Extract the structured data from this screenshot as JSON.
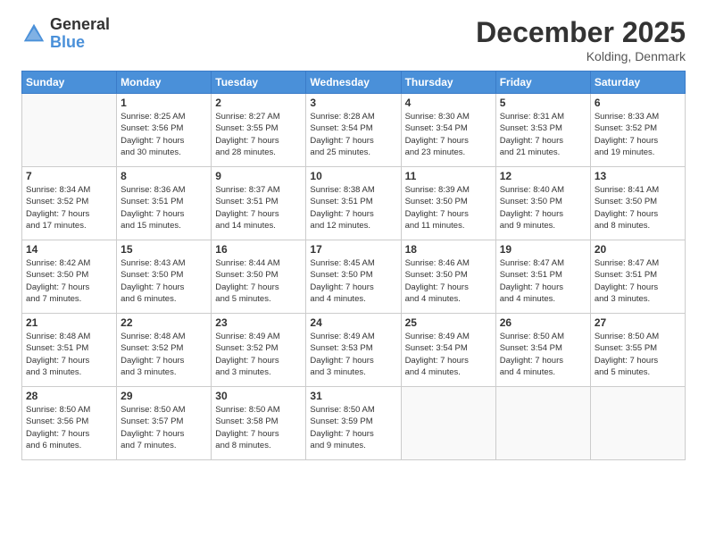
{
  "header": {
    "logo_general": "General",
    "logo_blue": "Blue",
    "title": "December 2025",
    "location": "Kolding, Denmark"
  },
  "days_of_week": [
    "Sunday",
    "Monday",
    "Tuesday",
    "Wednesday",
    "Thursday",
    "Friday",
    "Saturday"
  ],
  "weeks": [
    [
      {
        "day": null,
        "info": null
      },
      {
        "day": "1",
        "info": "Sunrise: 8:25 AM\nSunset: 3:56 PM\nDaylight: 7 hours\nand 30 minutes."
      },
      {
        "day": "2",
        "info": "Sunrise: 8:27 AM\nSunset: 3:55 PM\nDaylight: 7 hours\nand 28 minutes."
      },
      {
        "day": "3",
        "info": "Sunrise: 8:28 AM\nSunset: 3:54 PM\nDaylight: 7 hours\nand 25 minutes."
      },
      {
        "day": "4",
        "info": "Sunrise: 8:30 AM\nSunset: 3:54 PM\nDaylight: 7 hours\nand 23 minutes."
      },
      {
        "day": "5",
        "info": "Sunrise: 8:31 AM\nSunset: 3:53 PM\nDaylight: 7 hours\nand 21 minutes."
      },
      {
        "day": "6",
        "info": "Sunrise: 8:33 AM\nSunset: 3:52 PM\nDaylight: 7 hours\nand 19 minutes."
      }
    ],
    [
      {
        "day": "7",
        "info": "Sunrise: 8:34 AM\nSunset: 3:52 PM\nDaylight: 7 hours\nand 17 minutes."
      },
      {
        "day": "8",
        "info": "Sunrise: 8:36 AM\nSunset: 3:51 PM\nDaylight: 7 hours\nand 15 minutes."
      },
      {
        "day": "9",
        "info": "Sunrise: 8:37 AM\nSunset: 3:51 PM\nDaylight: 7 hours\nand 14 minutes."
      },
      {
        "day": "10",
        "info": "Sunrise: 8:38 AM\nSunset: 3:51 PM\nDaylight: 7 hours\nand 12 minutes."
      },
      {
        "day": "11",
        "info": "Sunrise: 8:39 AM\nSunset: 3:50 PM\nDaylight: 7 hours\nand 11 minutes."
      },
      {
        "day": "12",
        "info": "Sunrise: 8:40 AM\nSunset: 3:50 PM\nDaylight: 7 hours\nand 9 minutes."
      },
      {
        "day": "13",
        "info": "Sunrise: 8:41 AM\nSunset: 3:50 PM\nDaylight: 7 hours\nand 8 minutes."
      }
    ],
    [
      {
        "day": "14",
        "info": "Sunrise: 8:42 AM\nSunset: 3:50 PM\nDaylight: 7 hours\nand 7 minutes."
      },
      {
        "day": "15",
        "info": "Sunrise: 8:43 AM\nSunset: 3:50 PM\nDaylight: 7 hours\nand 6 minutes."
      },
      {
        "day": "16",
        "info": "Sunrise: 8:44 AM\nSunset: 3:50 PM\nDaylight: 7 hours\nand 5 minutes."
      },
      {
        "day": "17",
        "info": "Sunrise: 8:45 AM\nSunset: 3:50 PM\nDaylight: 7 hours\nand 4 minutes."
      },
      {
        "day": "18",
        "info": "Sunrise: 8:46 AM\nSunset: 3:50 PM\nDaylight: 7 hours\nand 4 minutes."
      },
      {
        "day": "19",
        "info": "Sunrise: 8:47 AM\nSunset: 3:51 PM\nDaylight: 7 hours\nand 4 minutes."
      },
      {
        "day": "20",
        "info": "Sunrise: 8:47 AM\nSunset: 3:51 PM\nDaylight: 7 hours\nand 3 minutes."
      }
    ],
    [
      {
        "day": "21",
        "info": "Sunrise: 8:48 AM\nSunset: 3:51 PM\nDaylight: 7 hours\nand 3 minutes."
      },
      {
        "day": "22",
        "info": "Sunrise: 8:48 AM\nSunset: 3:52 PM\nDaylight: 7 hours\nand 3 minutes."
      },
      {
        "day": "23",
        "info": "Sunrise: 8:49 AM\nSunset: 3:52 PM\nDaylight: 7 hours\nand 3 minutes."
      },
      {
        "day": "24",
        "info": "Sunrise: 8:49 AM\nSunset: 3:53 PM\nDaylight: 7 hours\nand 3 minutes."
      },
      {
        "day": "25",
        "info": "Sunrise: 8:49 AM\nSunset: 3:54 PM\nDaylight: 7 hours\nand 4 minutes."
      },
      {
        "day": "26",
        "info": "Sunrise: 8:50 AM\nSunset: 3:54 PM\nDaylight: 7 hours\nand 4 minutes."
      },
      {
        "day": "27",
        "info": "Sunrise: 8:50 AM\nSunset: 3:55 PM\nDaylight: 7 hours\nand 5 minutes."
      }
    ],
    [
      {
        "day": "28",
        "info": "Sunrise: 8:50 AM\nSunset: 3:56 PM\nDaylight: 7 hours\nand 6 minutes."
      },
      {
        "day": "29",
        "info": "Sunrise: 8:50 AM\nSunset: 3:57 PM\nDaylight: 7 hours\nand 7 minutes."
      },
      {
        "day": "30",
        "info": "Sunrise: 8:50 AM\nSunset: 3:58 PM\nDaylight: 7 hours\nand 8 minutes."
      },
      {
        "day": "31",
        "info": "Sunrise: 8:50 AM\nSunset: 3:59 PM\nDaylight: 7 hours\nand 9 minutes."
      },
      {
        "day": null,
        "info": null
      },
      {
        "day": null,
        "info": null
      },
      {
        "day": null,
        "info": null
      }
    ]
  ]
}
